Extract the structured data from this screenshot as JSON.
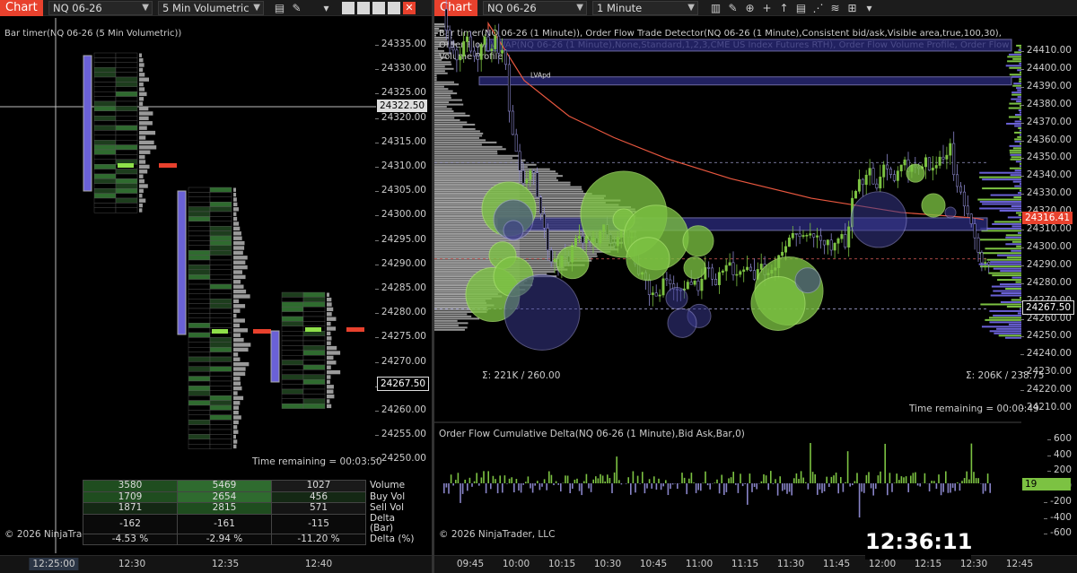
{
  "left": {
    "toolbar": {
      "chart_tab": "Chart",
      "instrument": "NQ 06-26",
      "bar_type": "5 Min Volumetric"
    },
    "title": "Bar timer(NQ 06-26 (5 Min Volumetric))",
    "price_ticks": [
      "24335.00",
      "24330.00",
      "24325.00",
      "24320.00",
      "24315.00",
      "24310.00",
      "24305.00",
      "24300.00",
      "24295.00",
      "24290.00",
      "24285.00",
      "24280.00",
      "24275.00",
      "24270.00",
      "24265.00",
      "24260.00",
      "24255.00",
      "24250.00"
    ],
    "crosshair_price": "24322.50",
    "last_price": "24267.50",
    "time_remaining": "Time remaining = 00:03:50",
    "copyright": "© 2026 NinjaTrader, LLC",
    "time_ticks": [
      "12:25:00",
      "12:30",
      "12:35",
      "12:40"
    ],
    "stats": {
      "labels": [
        "Volume",
        "Buy Vol",
        "Sell Vol",
        "Delta (Bar)",
        "Delta (%)"
      ],
      "columns": [
        [
          "3580",
          "1709",
          "1871",
          "-162",
          "-4.53 %"
        ],
        [
          "5469",
          "2654",
          "2815",
          "-161",
          "-2.94 %"
        ],
        [
          "1027",
          "456",
          "571",
          "-115",
          "-11.20 %"
        ]
      ]
    }
  },
  "right": {
    "toolbar": {
      "chart_tab": "Chart",
      "instrument": "NQ 06-26",
      "bar_type": "1 Minute"
    },
    "title": "Bar timer(NQ 06-26 (1 Minute)), Order Flow Trade Detector(NQ 06-26 (1 Minute),Consistent bid/ask,Visible area,true,100,30), Order Flow VWAP(NQ 06-26 (1 Minute),None,Standard,1,2,3,CME US Index Futures RTH), Order Flow Volume Profile, Order Flow Volume Profile",
    "price_ticks": [
      "24410.00",
      "24400.00",
      "24390.00",
      "24380.00",
      "24370.00",
      "24360.00",
      "24350.00",
      "24340.00",
      "24330.00",
      "24320.00",
      "24310.00",
      "24300.00",
      "24290.00",
      "24280.00",
      "24270.00",
      "24260.00",
      "24250.00",
      "24240.00",
      "24230.00",
      "24220.00",
      "24210.00"
    ],
    "vwap_price": "24316.41",
    "last_price": "24267.50",
    "lvapd_label": "LVApd",
    "profile_left_sum": "Σ: 221K / 260.00",
    "profile_right_sum": "Σ: 206K / 238.75",
    "time_remaining": "Time remaining = 00:00:49",
    "delta_title": "Order Flow Cumulative Delta(NQ 06-26 (1 Minute),Bid Ask,Bar,0)",
    "delta_ticks": [
      "600",
      "400",
      "200",
      "0",
      "-200",
      "-400",
      "-600"
    ],
    "delta_value": "19",
    "copyright": "© 2026 NinjaTrader, LLC",
    "time_ticks": [
      "09:45",
      "10:00",
      "10:15",
      "10:30",
      "10:45",
      "11:00",
      "11:15",
      "11:30",
      "11:45",
      "12:00",
      "12:15",
      "12:30",
      "12:45"
    ],
    "clock": "12:36:11"
  },
  "colors": {
    "accent_red": "#e8412d",
    "up_green": "#7cc242",
    "down_purple": "#8884c8",
    "volume_box": "#6a61d6",
    "vwap_line": "#e8573f"
  }
}
